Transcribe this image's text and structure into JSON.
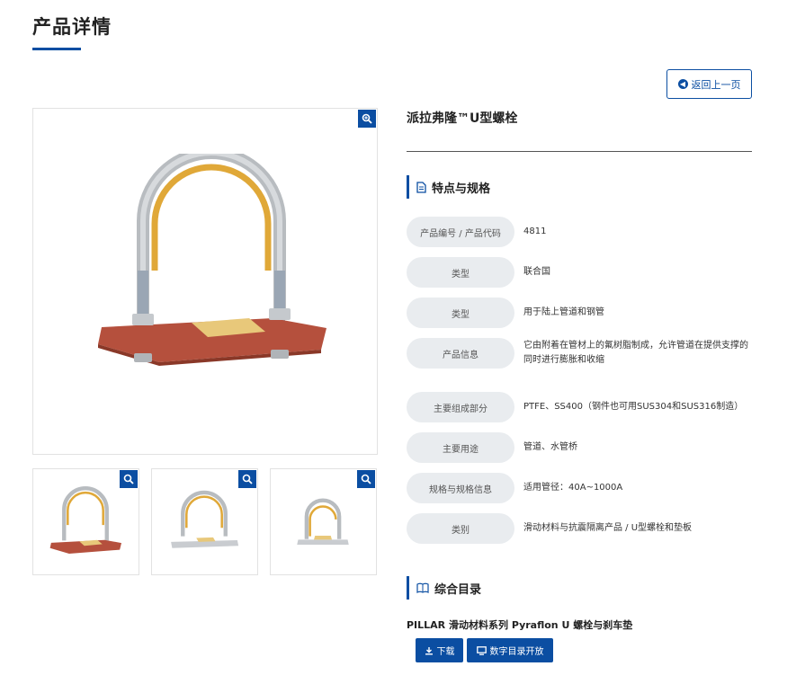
{
  "page": {
    "title": "产品详情"
  },
  "back_button": {
    "label": "返回上一页"
  },
  "product": {
    "name": "派拉弗隆™U型螺栓"
  },
  "specs": {
    "heading": "特点与规格",
    "rows": [
      {
        "label": "产品编号 / 产品代码",
        "value": "4811"
      },
      {
        "label": "类型",
        "value": "联合国"
      },
      {
        "label": "类型",
        "value": "用于陆上管道和钢管"
      },
      {
        "label": "产品信息",
        "value": "它由附着在管材上的氟树脂制成，允许管道在提供支撑的同时进行膨胀和收缩"
      },
      {
        "label": "主要组成部分",
        "value": "PTFE、SS400（钢件也可用SUS304和SUS316制造）"
      },
      {
        "label": "主要用途",
        "value": "管道、水管桥"
      },
      {
        "label": "规格与规格信息",
        "value": "适用管径：40A~1000A"
      },
      {
        "label": "类别",
        "value": "滑动材料与抗震隔离产品 / U型螺栓和垫板"
      }
    ]
  },
  "catalog": {
    "heading": "综合目录",
    "item_title": "PILLAR 滑动材料系列 Pyraflon U 螺栓与刹车垫",
    "download_label": "下载",
    "digital_label": "数字目录开放"
  },
  "colors": {
    "accent": "#0b4ea2",
    "plate": "#b5503d",
    "pad": "#e8c87a"
  },
  "icons": {
    "zoom": "zoom-in-icon",
    "back": "arrow-left-circle-icon",
    "doc": "document-icon",
    "book": "book-icon",
    "download": "download-icon",
    "monitor": "monitor-icon"
  }
}
